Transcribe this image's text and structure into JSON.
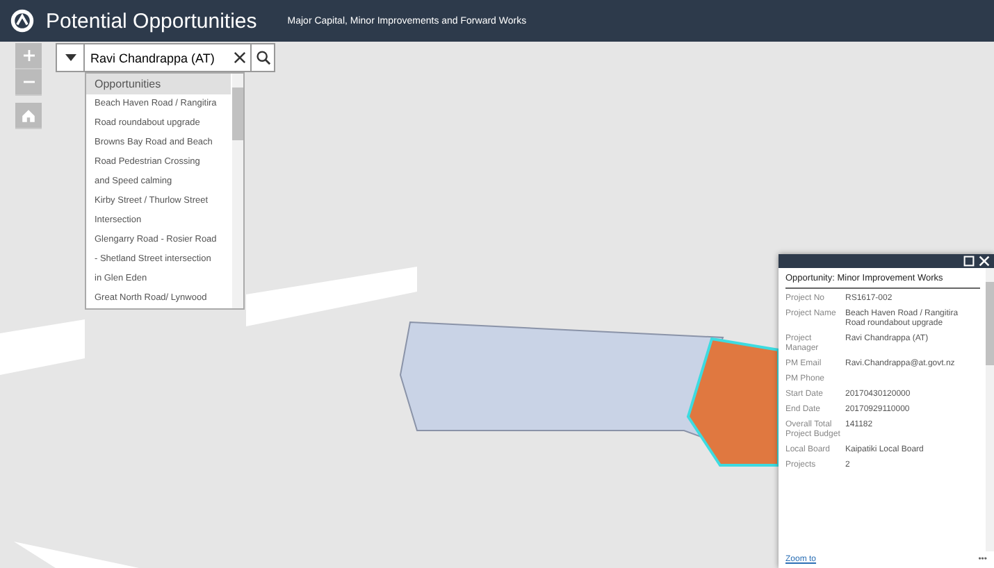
{
  "header": {
    "title": "Potential Opportunities",
    "subtitle": "Major Capital, Minor Improvements and Forward Works"
  },
  "search": {
    "value": "Ravi Chandrappa (AT)"
  },
  "dropdown": {
    "heading": "Opportunities",
    "items": [
      {
        "label": "Beach Haven Road / Rangitira"
      },
      {
        "label": "Road roundabout upgrade"
      },
      {
        "label": "Browns Bay Road and Beach"
      },
      {
        "label": "Road Pedestrian Crossing"
      },
      {
        "label": "and Speed calming"
      },
      {
        "label": "Kirby Street / Thurlow Street"
      },
      {
        "label": "Intersection"
      },
      {
        "label": "Glengarry Road - Rosier Road"
      },
      {
        "label": "- Shetland Street intersection"
      },
      {
        "label": "in Glen Eden"
      },
      {
        "label": "Great North Road/ Lynwood"
      }
    ]
  },
  "popup": {
    "title": "Opportunity: Minor Improvement Works",
    "fields": [
      {
        "label": "Project No",
        "value": "RS1617-002"
      },
      {
        "label": "Project Name",
        "value": "Beach Haven Road / Rangitira Road roundabout upgrade"
      },
      {
        "label": "Project Manager",
        "value": "Ravi Chandrappa (AT)"
      },
      {
        "label": "PM Email",
        "value": "Ravi.Chandrappa@at.govt.nz"
      },
      {
        "label": "PM Phone"
      },
      {
        "label": "Start Date",
        "value": "20170430120000"
      },
      {
        "label": "End Date",
        "value": "20170929110000"
      },
      {
        "label": "Overall Total Project Budget",
        "value": "141182"
      },
      {
        "label": "Local Board",
        "value": "Kaipatiki Local Board"
      },
      {
        "label": "Projects",
        "value": "2"
      }
    ],
    "link": "Zoom to",
    "more": "•••"
  }
}
